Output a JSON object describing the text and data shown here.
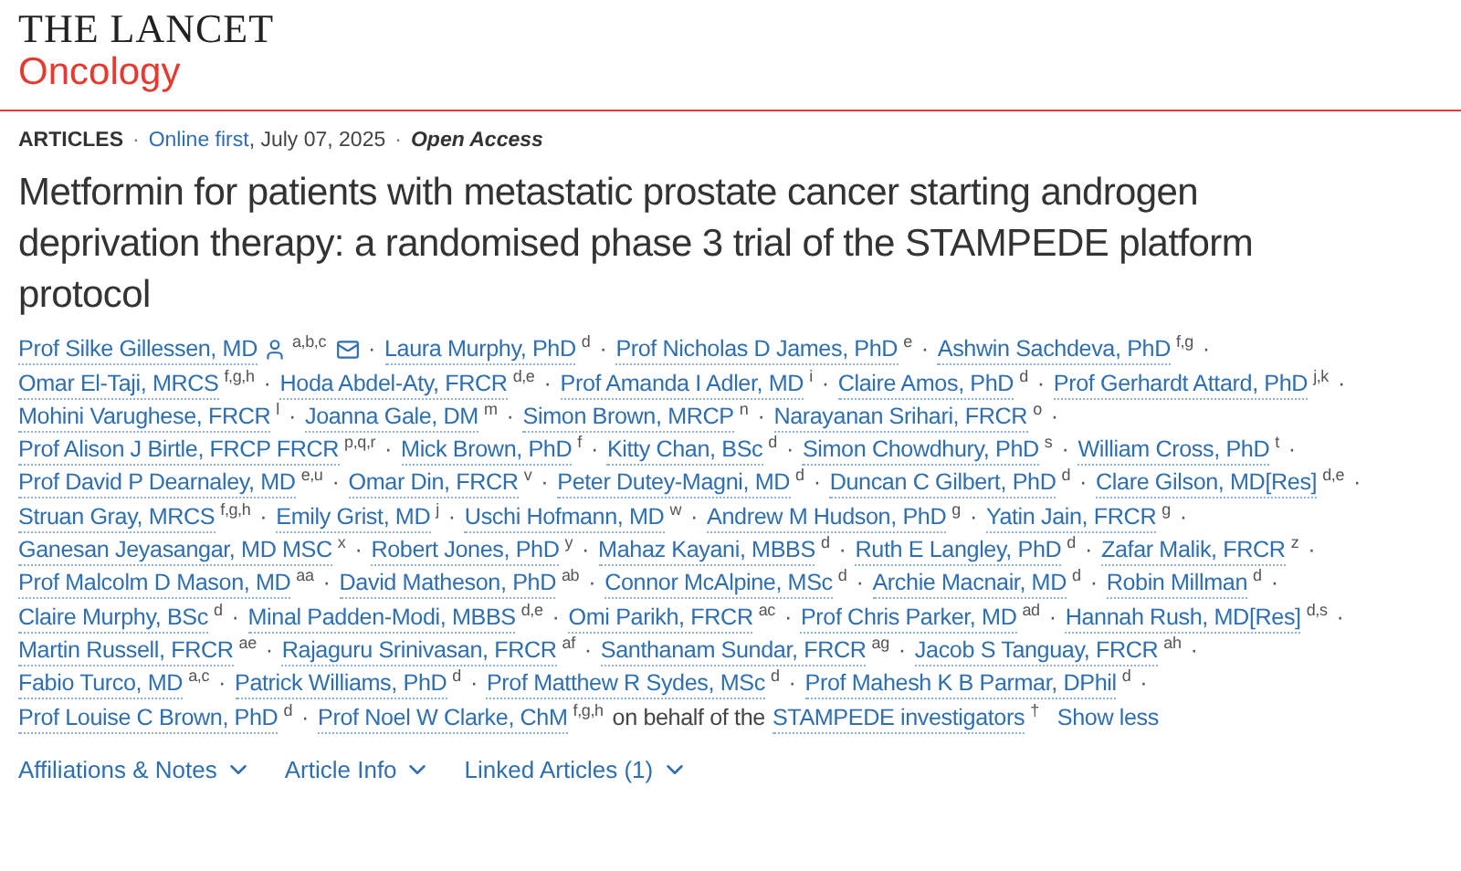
{
  "journal": {
    "name": "THE LANCET",
    "section": "Oncology"
  },
  "meta": {
    "type": "ARTICLES",
    "dot1": "·",
    "status": "Online first",
    "date": ", July 07, 2025",
    "dot2": "·",
    "access": "Open Access"
  },
  "title": "Metformin for patients with metastatic prostate cancer starting androgen deprivation therapy: a randomised phase 3 trial of the STAMPEDE platform protocol",
  "author_lines": [
    [
      {
        "name": "Prof Silke Gillessen, MD",
        "sup": "a,b,c",
        "corresponding": true,
        "separator": "·"
      },
      {
        "name": "Laura Murphy, PhD",
        "sup": "d",
        "corresponding": false,
        "separator": "·"
      },
      {
        "name": "Prof Nicholas D James, PhD",
        "sup": "e",
        "corresponding": false,
        "separator": "·"
      },
      {
        "name": "Ashwin Sachdeva, PhD",
        "sup": "f,g",
        "corresponding": false,
        "separator": "·"
      }
    ],
    [
      {
        "name": "Omar El-Taji, MRCS",
        "sup": "f,g,h",
        "corresponding": false,
        "separator": "·"
      },
      {
        "name": "Hoda Abdel-Aty, FRCR",
        "sup": "d,e",
        "corresponding": false,
        "separator": "·"
      },
      {
        "name": "Prof Amanda I Adler, MD",
        "sup": "i",
        "corresponding": false,
        "separator": "·"
      },
      {
        "name": "Claire Amos, PhD",
        "sup": "d",
        "corresponding": false,
        "separator": "·"
      },
      {
        "name": "Prof Gerhardt Attard, PhD",
        "sup": "j,k",
        "corresponding": false,
        "separator": "·"
      }
    ],
    [
      {
        "name": "Mohini Varughese, FRCR",
        "sup": "l",
        "corresponding": false,
        "separator": "·"
      },
      {
        "name": "Joanna Gale, DM",
        "sup": "m",
        "corresponding": false,
        "separator": "·"
      },
      {
        "name": "Simon Brown, MRCP",
        "sup": "n",
        "corresponding": false,
        "separator": "·"
      },
      {
        "name": "Narayanan Srihari, FRCR",
        "sup": "o",
        "corresponding": false,
        "separator": "·"
      }
    ],
    [
      {
        "name": "Prof Alison J Birtle, FRCP FRCR",
        "sup": "p,q,r",
        "corresponding": false,
        "separator": "·"
      },
      {
        "name": "Mick Brown, PhD",
        "sup": "f",
        "corresponding": false,
        "separator": "·"
      },
      {
        "name": "Kitty Chan, BSc",
        "sup": "d",
        "corresponding": false,
        "separator": "·"
      },
      {
        "name": "Simon Chowdhury, PhD",
        "sup": "s",
        "corresponding": false,
        "separator": "·"
      },
      {
        "name": "William Cross, PhD",
        "sup": "t",
        "corresponding": false,
        "separator": "·"
      }
    ],
    [
      {
        "name": "Prof David P Dearnaley, MD",
        "sup": "e,u",
        "corresponding": false,
        "separator": "·"
      },
      {
        "name": "Omar Din, FRCR",
        "sup": "v",
        "corresponding": false,
        "separator": "·"
      },
      {
        "name": "Peter Dutey-Magni, MD",
        "sup": "d",
        "corresponding": false,
        "separator": "·"
      },
      {
        "name": "Duncan C Gilbert, PhD",
        "sup": "d",
        "corresponding": false,
        "separator": "·"
      },
      {
        "name": "Clare Gilson, MD[Res]",
        "sup": "d,e",
        "corresponding": false,
        "separator": "·"
      }
    ],
    [
      {
        "name": "Struan Gray, MRCS",
        "sup": "f,g,h",
        "corresponding": false,
        "separator": "·"
      },
      {
        "name": "Emily Grist, MD",
        "sup": "j",
        "corresponding": false,
        "separator": "·"
      },
      {
        "name": "Uschi Hofmann, MD",
        "sup": "w",
        "corresponding": false,
        "separator": "·"
      },
      {
        "name": "Andrew M Hudson, PhD",
        "sup": "g",
        "corresponding": false,
        "separator": "·"
      },
      {
        "name": "Yatin Jain, FRCR",
        "sup": "g",
        "corresponding": false,
        "separator": "·"
      }
    ],
    [
      {
        "name": "Ganesan Jeyasangar, MD MSC",
        "sup": "x",
        "corresponding": false,
        "separator": "·"
      },
      {
        "name": "Robert Jones, PhD",
        "sup": "y",
        "corresponding": false,
        "separator": "·"
      },
      {
        "name": "Mahaz Kayani, MBBS",
        "sup": "d",
        "corresponding": false,
        "separator": "·"
      },
      {
        "name": "Ruth E Langley, PhD",
        "sup": "d",
        "corresponding": false,
        "separator": "·"
      },
      {
        "name": "Zafar Malik, FRCR",
        "sup": "z",
        "corresponding": false,
        "separator": "·"
      }
    ],
    [
      {
        "name": "Prof Malcolm D Mason, MD",
        "sup": "aa",
        "corresponding": false,
        "separator": "·"
      },
      {
        "name": "David Matheson, PhD",
        "sup": "ab",
        "corresponding": false,
        "separator": "·"
      },
      {
        "name": "Connor McAlpine, MSc",
        "sup": "d",
        "corresponding": false,
        "separator": "·"
      },
      {
        "name": "Archie Macnair, MD",
        "sup": "d",
        "corresponding": false,
        "separator": "·"
      },
      {
        "name": "Robin Millman",
        "sup": "d",
        "corresponding": false,
        "separator": "·"
      }
    ],
    [
      {
        "name": "Claire Murphy, BSc",
        "sup": "d",
        "corresponding": false,
        "separator": "·"
      },
      {
        "name": "Minal Padden-Modi, MBBS",
        "sup": "d,e",
        "corresponding": false,
        "separator": "·"
      },
      {
        "name": "Omi Parikh, FRCR",
        "sup": "ac",
        "corresponding": false,
        "separator": "·"
      },
      {
        "name": "Prof Chris Parker, MD",
        "sup": "ad",
        "corresponding": false,
        "separator": "·"
      },
      {
        "name": "Hannah Rush, MD[Res]",
        "sup": "d,s",
        "corresponding": false,
        "separator": "·"
      }
    ],
    [
      {
        "name": "Martin Russell, FRCR",
        "sup": "ae",
        "corresponding": false,
        "separator": "·"
      },
      {
        "name": "Rajaguru Srinivasan, FRCR",
        "sup": "af",
        "corresponding": false,
        "separator": "·"
      },
      {
        "name": "Santhanam Sundar, FRCR",
        "sup": "ag",
        "corresponding": false,
        "separator": "·"
      },
      {
        "name": "Jacob S Tanguay, FRCR",
        "sup": "ah",
        "corresponding": false,
        "separator": "·"
      }
    ],
    [
      {
        "name": "Fabio Turco, MD",
        "sup": "a,c",
        "corresponding": false,
        "separator": "·"
      },
      {
        "name": "Patrick Williams, PhD",
        "sup": "d",
        "corresponding": false,
        "separator": "·"
      },
      {
        "name": "Prof Matthew R Sydes, MSc",
        "sup": "d",
        "corresponding": false,
        "separator": "·"
      },
      {
        "name": "Prof Mahesh K B Parmar, DPhil",
        "sup": "d",
        "corresponding": false,
        "separator": "·"
      }
    ],
    [
      {
        "name": "Prof Louise C Brown, PhD",
        "sup": "d",
        "corresponding": false,
        "separator": "·"
      },
      {
        "name": "Prof Noel W Clarke, ChM",
        "sup": "f,g,h",
        "corresponding": false
      }
    ]
  ],
  "group": {
    "prefix": "on behalf of the",
    "name": "STAMPEDE investigators",
    "sup": "†",
    "toggle": "Show less"
  },
  "tabs": [
    {
      "label": "Affiliations & Notes"
    },
    {
      "label": "Article Info"
    },
    {
      "label": "Linked Articles (1)"
    }
  ]
}
